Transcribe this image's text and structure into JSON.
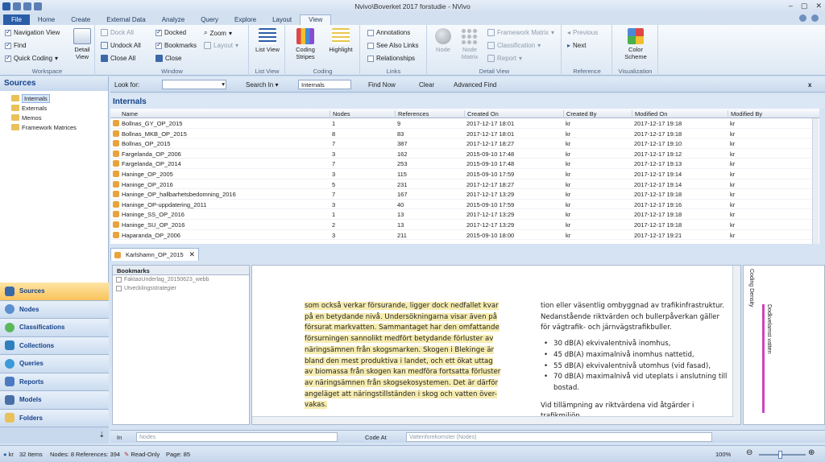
{
  "window": {
    "title": "Nvivo\\Boverket 2017 forstudie - NVivo"
  },
  "tabs": [
    "File",
    "Home",
    "Create",
    "External Data",
    "Analyze",
    "Query",
    "Explore",
    "Layout",
    "View"
  ],
  "ribbon": {
    "workspace": {
      "label": "Workspace",
      "navigation_view": "Navigation View",
      "find": "Find",
      "quick_coding": "Quick Coding",
      "detail_view": "Detail View"
    },
    "window": {
      "label": "Window",
      "dock_all": "Dock All",
      "undock_all": "Undock All",
      "close_all": "Close All",
      "docked": "Docked",
      "bookmarks": "Bookmarks",
      "close": "Close",
      "zoom": "Zoom",
      "layout": "Layout"
    },
    "list_view": {
      "label": "List View",
      "button": "List View"
    },
    "coding": {
      "label": "Coding",
      "coding_stripes": "Coding Stripes",
      "highlight": "Highlight"
    },
    "links": {
      "label": "Links",
      "annotations": "Annotations",
      "see_also_links": "See Also Links",
      "relationships": "Relationships"
    },
    "detail_view": {
      "label": "Detail View",
      "node": "Node",
      "node_matrix": "Node Matrix",
      "framework_matrix": "Framework Matrix",
      "classification": "Classification",
      "report": "Report"
    },
    "reference": {
      "label": "Reference",
      "previous": "Previous",
      "next": "Next"
    },
    "visualization": {
      "label": "Visualization",
      "color_scheme": "Color Scheme"
    }
  },
  "sources": {
    "title": "Sources",
    "tree": [
      "Internals",
      "Externals",
      "Memos",
      "Framework Matrices"
    ]
  },
  "nav": [
    "Sources",
    "Nodes",
    "Classifications",
    "Collections",
    "Queries",
    "Reports",
    "Models",
    "Folders"
  ],
  "findbar": {
    "look_for": "Look for:",
    "search_in": "Search In",
    "search_in_value": "Internals",
    "find_now": "Find Now",
    "clear": "Clear",
    "advanced_find": "Advanced Find",
    "close": "x"
  },
  "list": {
    "title": "Internals",
    "columns": [
      "Name",
      "Nodes",
      "References",
      "Created On",
      "Created By",
      "Modified On",
      "Modified By"
    ],
    "rows": [
      [
        "Bollnas_GY_OP_2015",
        "1",
        "9",
        "2017-12-17 18:01",
        "kr",
        "2017-12-17 19:18",
        "kr"
      ],
      [
        "Bollnas_MKB_OP_2015",
        "8",
        "83",
        "2017-12-17 18:01",
        "kr",
        "2017-12-17 19:18",
        "kr"
      ],
      [
        "Bollnas_OP_2015",
        "7",
        "387",
        "2017-12-17 18:27",
        "kr",
        "2017-12-17 19:10",
        "kr"
      ],
      [
        "Fargelanda_OP_2006",
        "3",
        "162",
        "2015-09-10 17:48",
        "kr",
        "2017-12-17 19:12",
        "kr"
      ],
      [
        "Fargelanda_OP_2014",
        "7",
        "253",
        "2015-09-10 17:48",
        "kr",
        "2017-12-17 19:13",
        "kr"
      ],
      [
        "Haninge_OP_2005",
        "3",
        "115",
        "2015-09-10 17:59",
        "kr",
        "2017-12-17 19:14",
        "kr"
      ],
      [
        "Haninge_OP_2016",
        "5",
        "231",
        "2017-12-17 18:27",
        "kr",
        "2017-12-17 19:14",
        "kr"
      ],
      [
        "Haninge_OP_hallbarhetsbedomning_2016",
        "7",
        "167",
        "2017-12-17 13:29",
        "kr",
        "2017-12-17 19:18",
        "kr"
      ],
      [
        "Haninge_OP-uppdatering_2011",
        "3",
        "40",
        "2015-09-10 17:59",
        "kr",
        "2017-12-17 19:16",
        "kr"
      ],
      [
        "Haninge_SS_OP_2016",
        "1",
        "13",
        "2017-12-17 13:29",
        "kr",
        "2017-12-17 19:18",
        "kr"
      ],
      [
        "Haninge_SU_OP_2016",
        "2",
        "13",
        "2017-12-17 13:29",
        "kr",
        "2017-12-17 19:18",
        "kr"
      ],
      [
        "Haparanda_OP_2006",
        "3",
        "211",
        "2015-09-10 18:00",
        "kr",
        "2017-12-17 19:21",
        "kr"
      ]
    ]
  },
  "document": {
    "tab": "Karlshamn_OP_2015",
    "bookmarks_title": "Bookmarks",
    "bookmarks": [
      "FaktaoUnderlag_20150623_webb",
      "Utvecklingsstrategier"
    ],
    "col1_lines": [
      "som också verkar försurande, ligger dock nedfallet kvar",
      "på en betydande nivå. Undersökningarna visar även på",
      "försurat markvatten. Sammantaget har den omfattande",
      "försurningen sannolikt medfört betydande förluster av",
      "näringsämnen från skogsmarken. Skogen i Blekinge är",
      "bland den mest produktiva i landet, och ett ökat uttag",
      "av biomassa från skogen kan medföra fortsatta förluster",
      "av näringsämnen från skogsekosystemen. Det är därför",
      "angeläget att näringstillständen i skog och vatten över-",
      "vakas."
    ],
    "col2_intro": "tion eller väsentlig ombyggnad av trafikinfrastruktur. Nedanstående riktvärden och bullerpåverkan gäller för vägtrafik- och järnvägstrafikbuller.",
    "col2_bullets": [
      "30 dB(A) ekvivalentnivå inomhus,",
      "45 dB(A) maximalnivå inomhus nattetid,",
      "55 dB(A) ekvivalentnivå utomhus (vid fasad),",
      "70 dB(A) maximalnivå vid uteplats i anslutning till bostad."
    ],
    "col2_tail": "Vid tillämpning av riktvärdena vid åtgärder i trafikmiljön"
  },
  "coding_stripes": {
    "density": "Coding Density",
    "node": "Dodkvelamst vatten"
  },
  "codebar": {
    "in": "In",
    "in_value": "Nodes",
    "code_at": "Code At",
    "code_at_value": "Vattenforekomster (Nodes)"
  },
  "status": {
    "user": "kr",
    "items": "32 Items",
    "nodes": "Nodes: 8",
    "references": "References: 394",
    "read_only": "Read-Only",
    "page": "Page: 85",
    "zoom": "100%"
  }
}
